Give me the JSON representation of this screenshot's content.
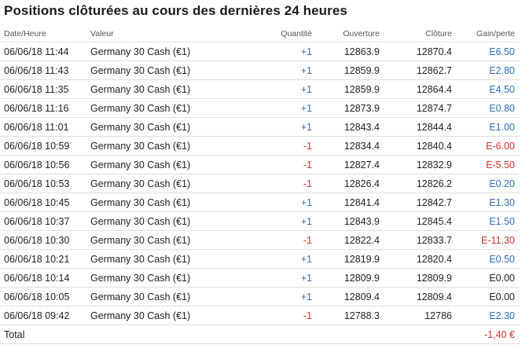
{
  "title": "Positions clôturées au cours des dernières 24 heures",
  "columns": {
    "date": "Date/Heure",
    "value": "Valeur",
    "qty": "Quantité",
    "open": "Ouverture",
    "close": "Clôture",
    "pl": "Gain/perte"
  },
  "rows": [
    {
      "date": "06/06/18 11:44",
      "value": "Germany 30 Cash (€1)",
      "qty": "+1",
      "open": "12863.9",
      "close": "12870.4",
      "pl": "E6.50",
      "sign": "pos"
    },
    {
      "date": "06/06/18 11:43",
      "value": "Germany 30 Cash (€1)",
      "qty": "+1",
      "open": "12859.9",
      "close": "12862.7",
      "pl": "E2.80",
      "sign": "pos"
    },
    {
      "date": "06/06/18 11:35",
      "value": "Germany 30 Cash (€1)",
      "qty": "+1",
      "open": "12859.9",
      "close": "12864.4",
      "pl": "E4.50",
      "sign": "pos"
    },
    {
      "date": "06/06/18 11:16",
      "value": "Germany 30 Cash (€1)",
      "qty": "+1",
      "open": "12873.9",
      "close": "12874.7",
      "pl": "E0.80",
      "sign": "pos"
    },
    {
      "date": "06/06/18 11:01",
      "value": "Germany 30 Cash (€1)",
      "qty": "+1",
      "open": "12843.4",
      "close": "12844.4",
      "pl": "E1.00",
      "sign": "pos"
    },
    {
      "date": "06/06/18 10:59",
      "value": "Germany 30 Cash (€1)",
      "qty": "-1",
      "open": "12834.4",
      "close": "12840.4",
      "pl": "E-6.00",
      "sign": "neg"
    },
    {
      "date": "06/06/18 10:56",
      "value": "Germany 30 Cash (€1)",
      "qty": "-1",
      "open": "12827.4",
      "close": "12832.9",
      "pl": "E-5.50",
      "sign": "neg"
    },
    {
      "date": "06/06/18 10:53",
      "value": "Germany 30 Cash (€1)",
      "qty": "-1",
      "open": "12826.4",
      "close": "12826.2",
      "pl": "E0.20",
      "sign": "pos"
    },
    {
      "date": "06/06/18 10:45",
      "value": "Germany 30 Cash (€1)",
      "qty": "+1",
      "open": "12841.4",
      "close": "12842.7",
      "pl": "E1.30",
      "sign": "pos"
    },
    {
      "date": "06/06/18 10:37",
      "value": "Germany 30 Cash (€1)",
      "qty": "+1",
      "open": "12843.9",
      "close": "12845.4",
      "pl": "E1.50",
      "sign": "pos"
    },
    {
      "date": "06/06/18 10:30",
      "value": "Germany 30 Cash (€1)",
      "qty": "-1",
      "open": "12822.4",
      "close": "12833.7",
      "pl": "E-11.30",
      "sign": "neg"
    },
    {
      "date": "06/06/18 10:21",
      "value": "Germany 30 Cash (€1)",
      "qty": "+1",
      "open": "12819.9",
      "close": "12820.4",
      "pl": "E0.50",
      "sign": "pos"
    },
    {
      "date": "06/06/18 10:14",
      "value": "Germany 30 Cash (€1)",
      "qty": "+1",
      "open": "12809.9",
      "close": "12809.9",
      "pl": "E0.00",
      "sign": "zero"
    },
    {
      "date": "06/06/18 10:05",
      "value": "Germany 30 Cash (€1)",
      "qty": "+1",
      "open": "12809.4",
      "close": "12809.4",
      "pl": "E0.00",
      "sign": "zero"
    },
    {
      "date": "06/06/18 09:42",
      "value": "Germany 30 Cash (€1)",
      "qty": "-1",
      "open": "12788.3",
      "close": "12786",
      "pl": "E2.30",
      "sign": "pos"
    }
  ],
  "total": {
    "label": "Total",
    "value": "-1,40 €",
    "sign": "neg"
  },
  "colors": {
    "positive": "#2f6fb8",
    "negative": "#d0342c",
    "neutral": "#222222"
  }
}
